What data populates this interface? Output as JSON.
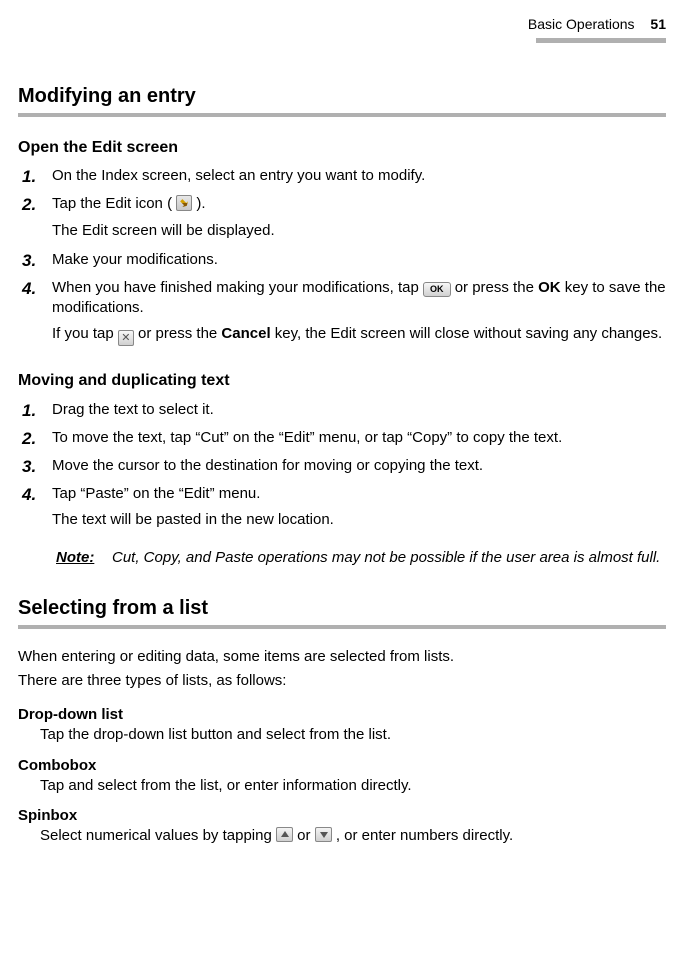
{
  "header": {
    "section": "Basic Operations",
    "page": "51"
  },
  "h_modifying": "Modifying an entry",
  "h_open_edit": "Open the Edit screen",
  "open_edit_steps": {
    "1": "On the Index screen, select an entry you want to modify.",
    "2a": "Tap the Edit icon (",
    "2b": ").",
    "2sub": "The Edit screen will be displayed.",
    "3": "Make your modifications.",
    "4a": "When you have finished making your modifications, tap ",
    "4b": " or press the ",
    "4c": "OK",
    "4d": " key to save the modifications.",
    "4sub_a": "If you tap ",
    "4sub_b": " or press the ",
    "4sub_c": "Cancel",
    "4sub_d": " key, the Edit screen will close without saving any changes."
  },
  "h_moving": "Moving and duplicating text",
  "moving_steps": {
    "1": "Drag the text to select it.",
    "2": "To move the text, tap “Cut” on the “Edit” menu, or tap “Copy” to copy the text.",
    "3": "Move the cursor to the destination for moving or copying the text.",
    "4": "Tap “Paste” on the “Edit” menu.",
    "4sub": "The text will be pasted in the new location."
  },
  "note_label": "Note:",
  "note_body": "Cut, Copy, and Paste operations may not be possible if the user area is almost full.",
  "h_selecting": "Selecting from a list",
  "selecting_intro1": "When entering or editing data, some items are selected from lists.",
  "selecting_intro2": "There are three types of lists, as follows:",
  "dropdown_title": "Drop-down list",
  "dropdown_desc": "Tap the drop-down list button and select from the list.",
  "combo_title": "Combobox",
  "combo_desc": "Tap and select from the list, or enter information directly.",
  "spin_title": "Spinbox",
  "spin_a": "Select numerical values by tapping ",
  "spin_b": " or ",
  "spin_c": ", or enter numbers directly.",
  "icon_ok_label": "OK",
  "icon_cancel_label": "✕",
  "nums": {
    "1": "1.",
    "2": "2.",
    "3": "3.",
    "4": "4."
  }
}
